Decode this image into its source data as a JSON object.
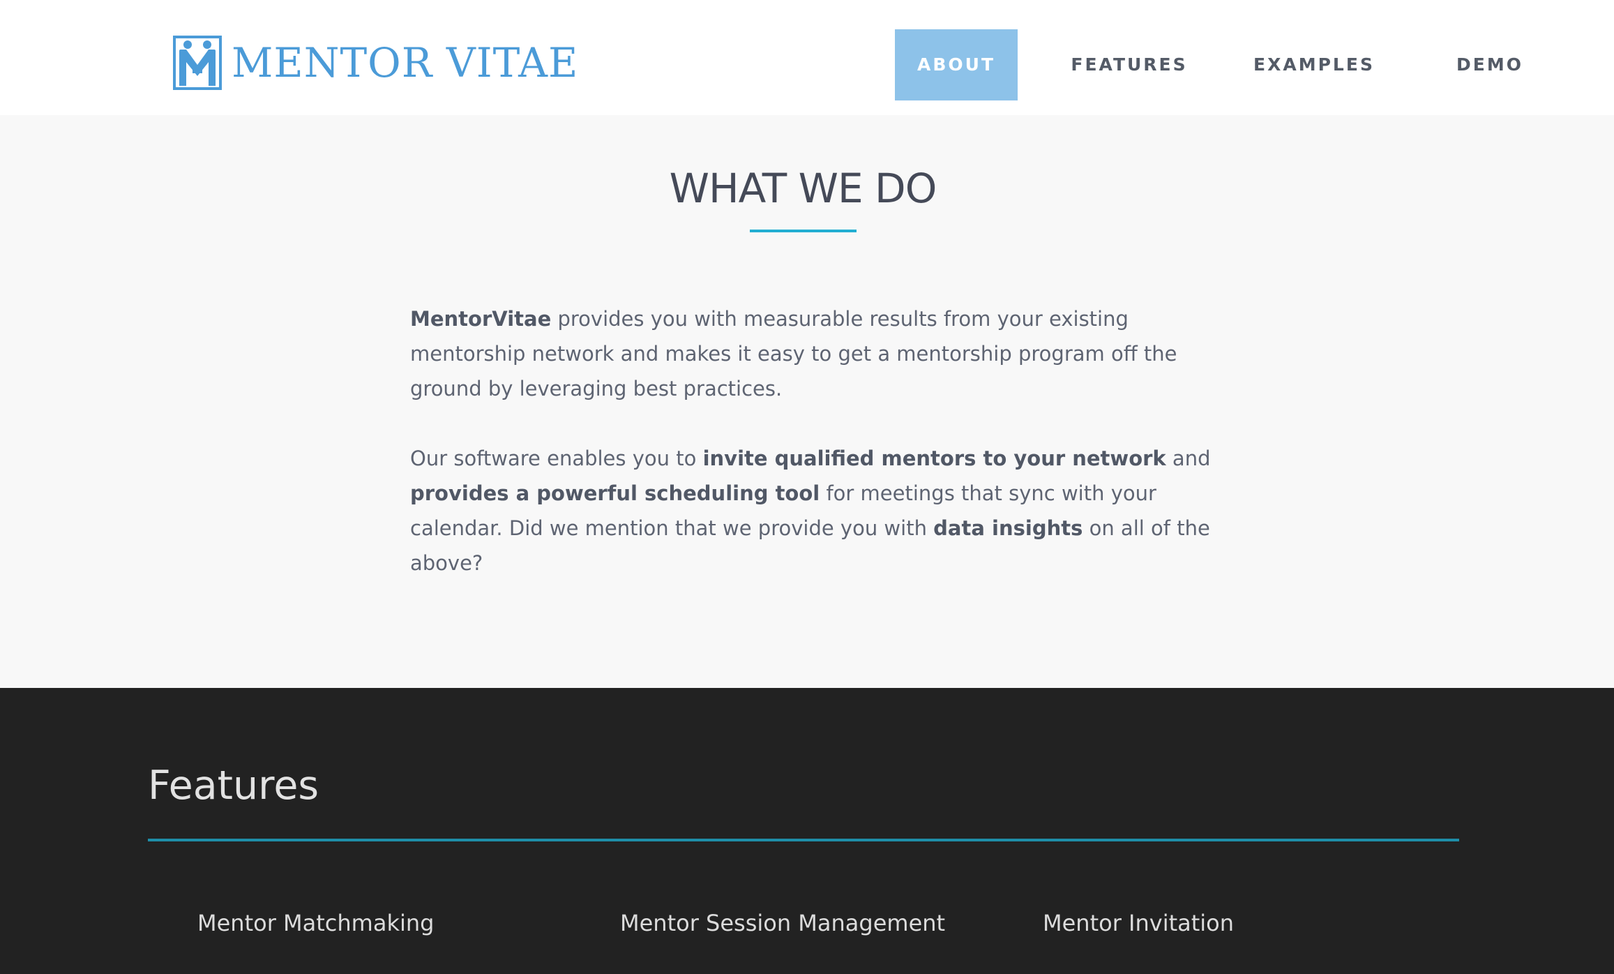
{
  "header": {
    "logo_text": "MENTOR VITAE",
    "logo_icon": "mentor-vitae-logo-icon",
    "brand_color": "#4b9bd8",
    "nav": [
      {
        "label": "ABOUT",
        "active": true
      },
      {
        "label": "FEATURES",
        "active": false
      },
      {
        "label": "EXAMPLES",
        "active": false
      },
      {
        "label": "DEMO",
        "active": false
      }
    ],
    "active_color": "#8dc2e9"
  },
  "about": {
    "title": "WHAT WE DO",
    "accent_color": "#23aed2",
    "p1": {
      "b1": "MentorVitae",
      "t1": " provides you with measurable results from your existing mentorship network and makes it easy to get a mentorship program off the ground by leveraging best practices."
    },
    "p2": {
      "t1": "Our software enables you to ",
      "b1": "invite qualified mentors to your network",
      "t2": " and ",
      "b2": "provides a powerful scheduling tool",
      "t3": " for meetings that sync with your calendar. Did we mention that we provide you with ",
      "b3": "data insights",
      "t4": " on all of the above?"
    }
  },
  "features": {
    "title": "Features",
    "rule_color": "#1e8ea8",
    "items": [
      {
        "label": "Mentor Matchmaking"
      },
      {
        "label": "Mentor Session Management"
      },
      {
        "label": "Mentor Invitation"
      }
    ]
  }
}
